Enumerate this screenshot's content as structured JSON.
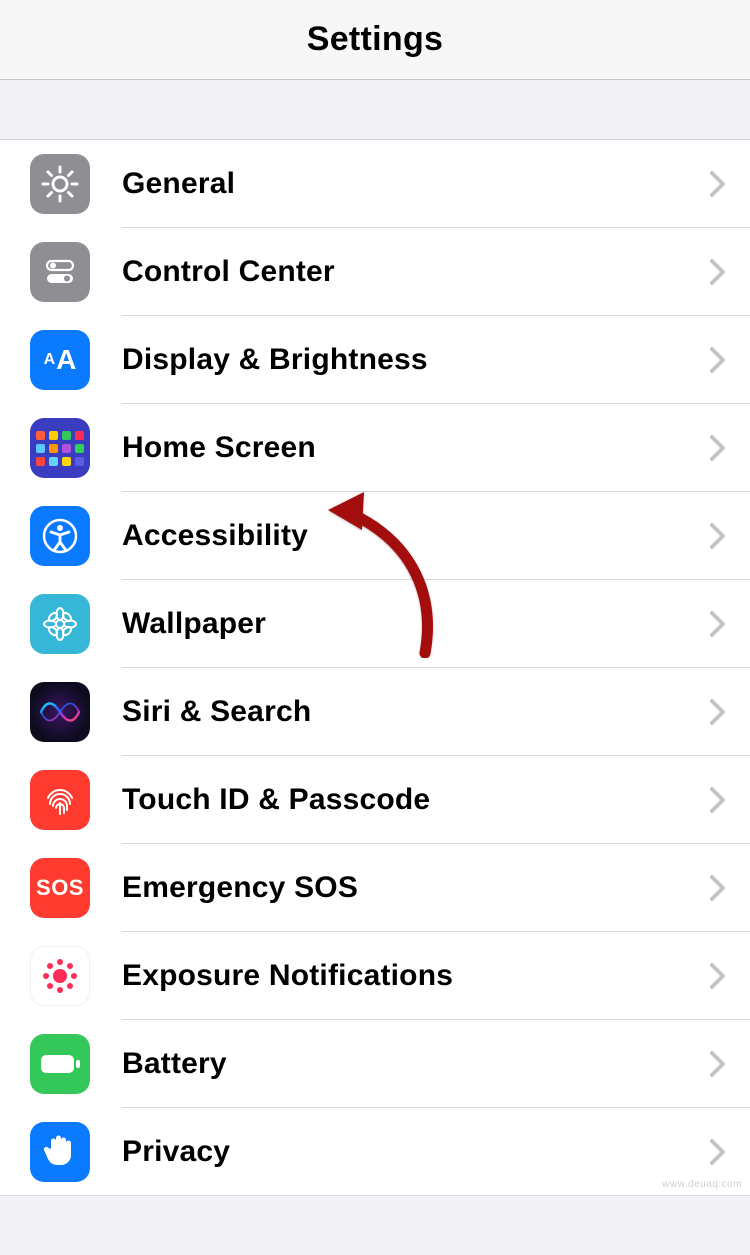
{
  "header": {
    "title": "Settings"
  },
  "rows": [
    {
      "id": "general",
      "label": "General",
      "icon": "gear",
      "bg": "#8e8e93"
    },
    {
      "id": "control-center",
      "label": "Control Center",
      "icon": "toggles",
      "bg": "#8e8e93"
    },
    {
      "id": "display",
      "label": "Display & Brightness",
      "icon": "aa",
      "bg": "#0a7aff"
    },
    {
      "id": "home-screen",
      "label": "Home Screen",
      "icon": "grid",
      "bg": "#2e3192"
    },
    {
      "id": "accessibility",
      "label": "Accessibility",
      "icon": "accessibility",
      "bg": "#0a7aff"
    },
    {
      "id": "wallpaper",
      "label": "Wallpaper",
      "icon": "flower",
      "bg": "#36b7d8"
    },
    {
      "id": "siri",
      "label": "Siri & Search",
      "icon": "siri",
      "bg": "#1a1a2e"
    },
    {
      "id": "touch-id",
      "label": "Touch ID & Passcode",
      "icon": "fingerprint",
      "bg": "#ff3b30"
    },
    {
      "id": "sos",
      "label": "Emergency SOS",
      "icon": "sos",
      "bg": "#ff3b30"
    },
    {
      "id": "exposure",
      "label": "Exposure Notifications",
      "icon": "exposure",
      "bg": "#ffffff"
    },
    {
      "id": "battery",
      "label": "Battery",
      "icon": "battery",
      "bg": "#34c759"
    },
    {
      "id": "privacy",
      "label": "Privacy",
      "icon": "hand",
      "bg": "#0a7aff"
    }
  ],
  "annotation": {
    "target": "accessibility"
  },
  "watermark": "www.deuaq.com"
}
